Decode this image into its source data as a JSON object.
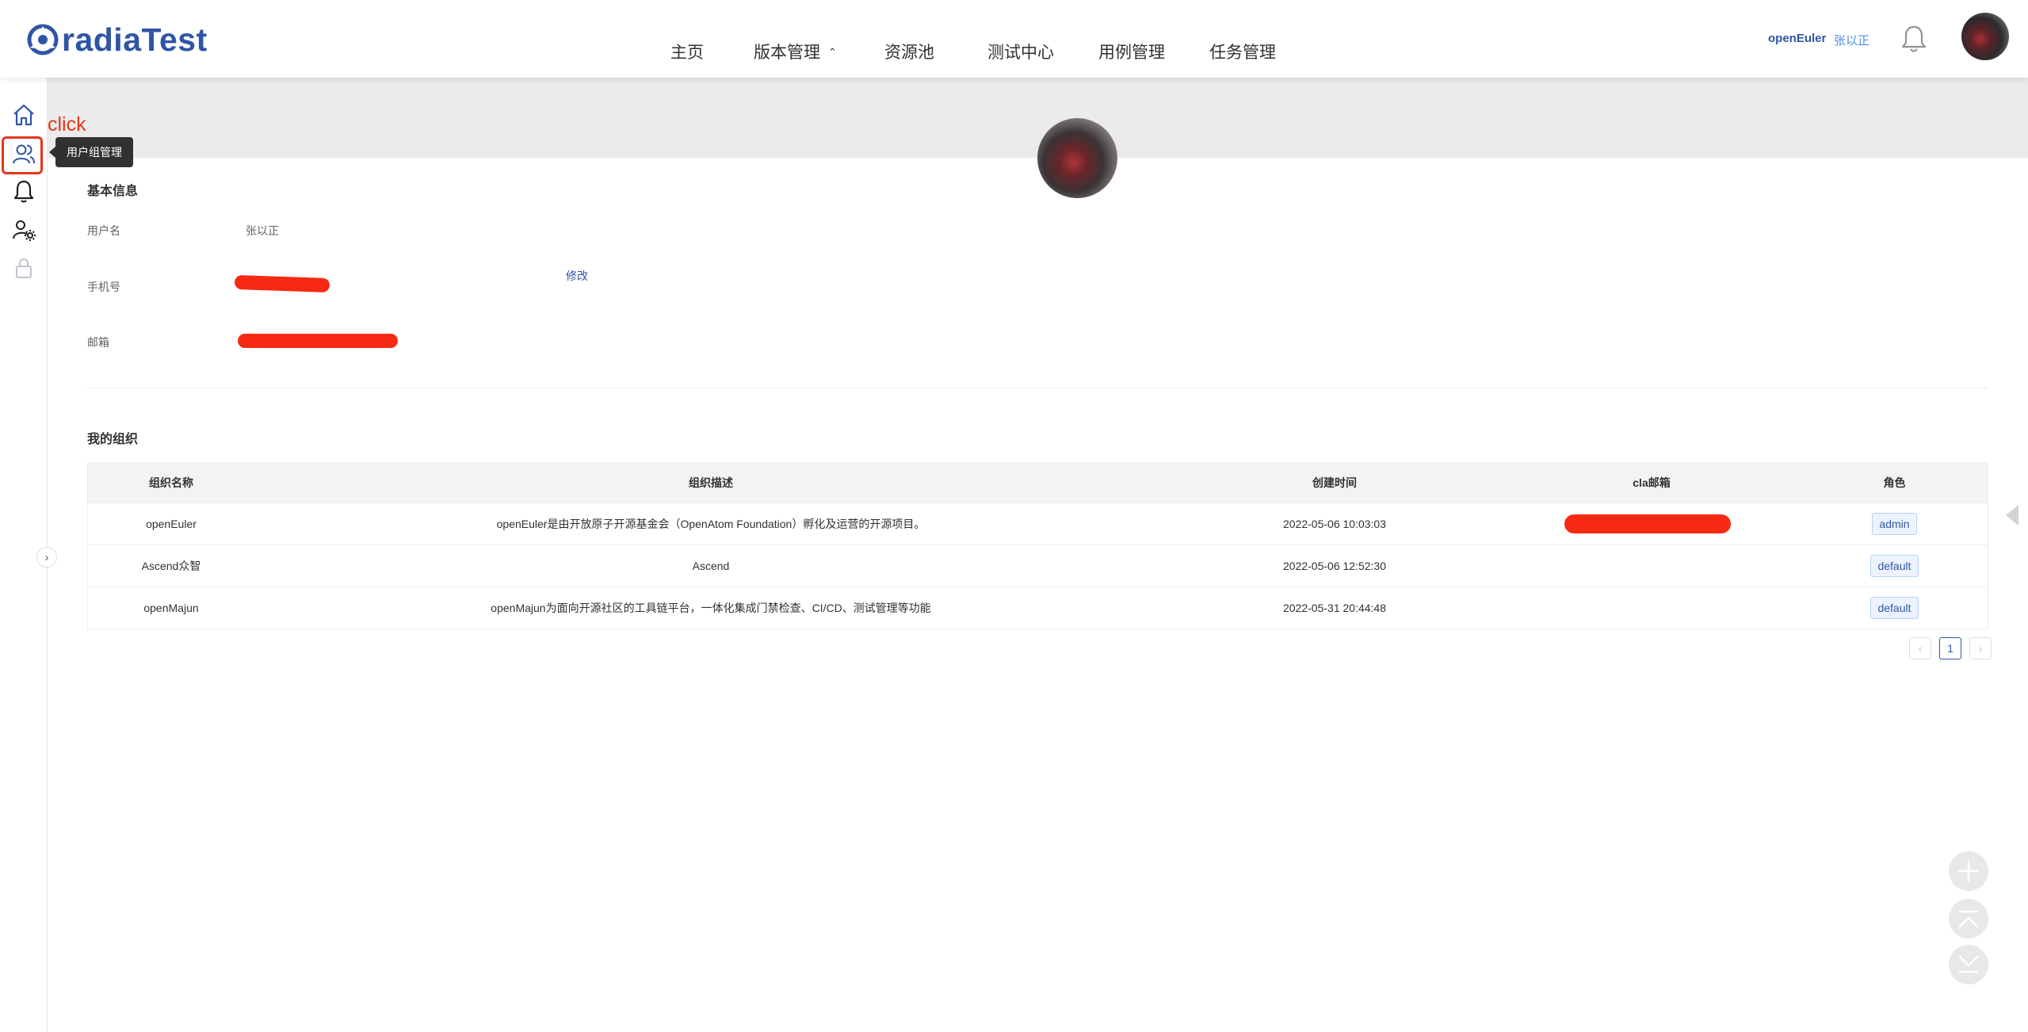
{
  "header": {
    "logo_text": "radiaTest",
    "nav": [
      {
        "label": "主页"
      },
      {
        "label": "版本管理",
        "has_caret": true
      },
      {
        "label": "资源池"
      },
      {
        "label": "测试中心"
      },
      {
        "label": "用例管理"
      },
      {
        "label": "任务管理"
      }
    ],
    "caret": "⌃",
    "org": "openEuler",
    "user": "张以正",
    "icons": {
      "bell": "bell-icon",
      "avatar": "user-avatar"
    }
  },
  "sidebar": {
    "items": [
      {
        "icon": "home-icon"
      },
      {
        "icon": "user-group-icon"
      },
      {
        "icon": "bell-icon"
      },
      {
        "icon": "user-settings-icon"
      },
      {
        "icon": "lock-icon"
      }
    ],
    "tooltip": "用户组管理",
    "annotation": "click",
    "toggle": "›"
  },
  "profile": {
    "basic_title": "基本信息",
    "username_label": "用户名",
    "username_value": "张以正",
    "phone_label": "手机号",
    "email_label": "邮箱",
    "edit_label": "修改"
  },
  "orgs": {
    "title": "我的组织",
    "columns": [
      "组织名称",
      "组织描述",
      "创建时间",
      "cla邮箱",
      "角色"
    ],
    "rows": [
      {
        "name": "openEuler",
        "desc": "openEuler是由开放原子开源基金会（OpenAtom Foundation）孵化及运营的开源项目。",
        "created": "2022-05-06 10:03:03",
        "cla": "",
        "role": "admin"
      },
      {
        "name": "Ascend众智",
        "desc": "Ascend",
        "created": "2022-05-06 12:52:30",
        "cla": "",
        "role": "default"
      },
      {
        "name": "openMajun",
        "desc": "openMajun为面向开源社区的工具链平台，一体化集成门禁检查、CI/CD、测试管理等功能",
        "created": "2022-05-31 20:44:48",
        "cla": "",
        "role": "default"
      }
    ]
  },
  "pagination": {
    "prev": "‹",
    "current": "1",
    "next": "›"
  },
  "float_buttons": [
    {
      "icon": "plus-icon"
    },
    {
      "icon": "scroll-top-icon"
    },
    {
      "icon": "scroll-bottom-icon"
    }
  ],
  "colors": {
    "brand": "#2f55a4",
    "accent_link": "#4e8ee6",
    "annotation_red": "#e5371a",
    "redaction": "#f62a13"
  }
}
